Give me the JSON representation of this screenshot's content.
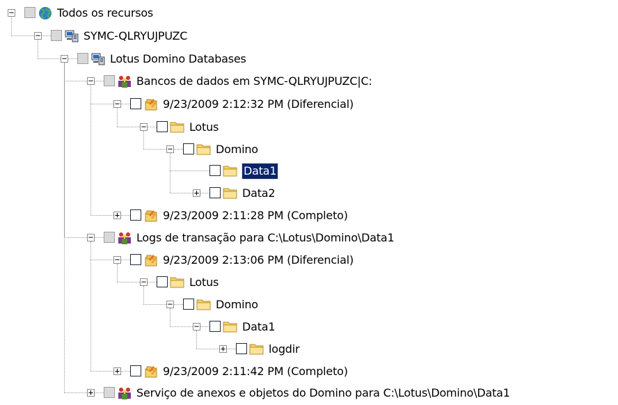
{
  "tree": {
    "nodes": [
      {
        "label": "Todos os recursos",
        "icon": "globe-icon",
        "expander": "-",
        "checkbox": "gray"
      },
      {
        "label": "SYMC-QLRYUJPUZC",
        "icon": "computer-icon",
        "expander": "-",
        "checkbox": "gray"
      },
      {
        "label": "Lotus Domino Databases",
        "icon": "computer-icon",
        "expander": "-",
        "checkbox": "gray"
      },
      {
        "label": "Bancos de dados em SYMC-QLRYUJPUZC|C:",
        "icon": "database-group-icon",
        "expander": "-",
        "checkbox": "gray"
      },
      {
        "label": "9/23/2009 2:12:32 PM (Diferencial)",
        "icon": "backup-set-icon",
        "expander": "-",
        "checkbox": "empty"
      },
      {
        "label": "Lotus",
        "icon": "folder-icon",
        "expander": "-",
        "checkbox": "empty"
      },
      {
        "label": "Domino",
        "icon": "folder-icon",
        "expander": "-",
        "checkbox": "empty"
      },
      {
        "label": "Data1",
        "icon": "folder-icon",
        "expander": "",
        "checkbox": "empty",
        "selected": true
      },
      {
        "label": "Data2",
        "icon": "folder-icon",
        "expander": "+",
        "checkbox": "empty"
      },
      {
        "label": "9/23/2009 2:11:28 PM (Completo)",
        "icon": "backup-set-icon",
        "expander": "+",
        "checkbox": "empty"
      },
      {
        "label": "Logs de transação para C:\\Lotus\\Domino\\Data1",
        "icon": "database-group-icon",
        "expander": "-",
        "checkbox": "gray"
      },
      {
        "label": "9/23/2009 2:13:06 PM (Diferencial)",
        "icon": "backup-set-icon",
        "expander": "-",
        "checkbox": "empty"
      },
      {
        "label": "Lotus",
        "icon": "folder-icon",
        "expander": "-",
        "checkbox": "empty"
      },
      {
        "label": "Domino",
        "icon": "folder-icon",
        "expander": "-",
        "checkbox": "empty"
      },
      {
        "label": "Data1",
        "icon": "folder-icon",
        "expander": "-",
        "checkbox": "empty"
      },
      {
        "label": "logdir",
        "icon": "folder-icon",
        "expander": "+",
        "checkbox": "empty"
      },
      {
        "label": "9/23/2009 2:11:42 PM (Completo)",
        "icon": "backup-set-icon",
        "expander": "+",
        "checkbox": "empty"
      },
      {
        "label": "Serviço de anexos e objetos do Domino para C:\\Lotus\\Domino\\Data1",
        "icon": "database-group-icon",
        "expander": "+",
        "checkbox": "gray"
      }
    ]
  },
  "colors": {
    "selection_bg": "#0a246a",
    "folder_yellow": "#f5d36b",
    "globe_blue": "#2f80c8"
  }
}
